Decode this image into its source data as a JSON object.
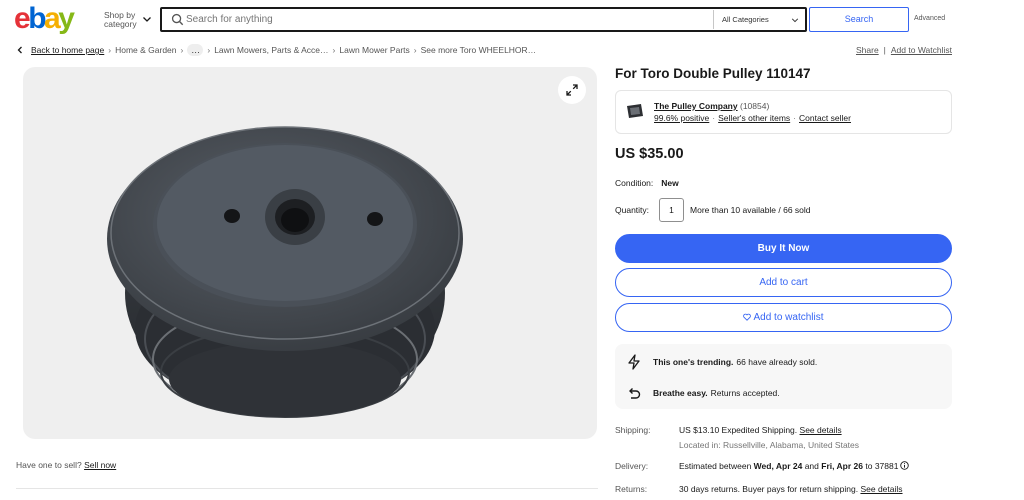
{
  "header": {
    "logo": {
      "e": "e",
      "b": "b",
      "a": "a",
      "y": "y"
    },
    "shop_by_category": "Shop by category",
    "search_placeholder": "Search for anything",
    "category_select": "All Categories",
    "search_button": "Search",
    "advanced": "Advanced"
  },
  "breadcrumb": {
    "back": "Back to home page",
    "items": [
      "Home & Garden",
      "…",
      "Lawn Mowers, Parts & Acce…",
      "Lawn Mower Parts",
      "See more Toro WHEELHOR…"
    ],
    "share": "Share",
    "watchlist": "Add to Watchlist"
  },
  "sell": {
    "prompt": "Have one to sell?",
    "link": "Sell now"
  },
  "product": {
    "title": "For Toro Double Pulley 110147",
    "price": "US $35.00",
    "condition_label": "Condition:",
    "condition_value": "New",
    "quantity_label": "Quantity:",
    "quantity_value": "1",
    "availability": "More than 10 available / 66 sold"
  },
  "seller": {
    "name": "The Pulley Company",
    "feedback": "(10854)",
    "positive": "99.6% positive",
    "other_items": "Seller's other items",
    "contact": "Contact seller"
  },
  "actions": {
    "buy": "Buy It Now",
    "cart": "Add to cart",
    "watch": "Add to watchlist"
  },
  "highlights": {
    "trending_bold": "This one's trending.",
    "trending_text": "66 have already sold.",
    "returns_bold": "Breathe easy.",
    "returns_text": "Returns accepted."
  },
  "details": {
    "shipping_label": "Shipping:",
    "shipping_value": "US $13.10 Expedited Shipping.",
    "shipping_link": "See details",
    "location": "Located in: Russellville, Alabama, United States",
    "delivery_label": "Delivery:",
    "delivery_prefix": "Estimated between",
    "delivery_start": "Wed, Apr 24",
    "delivery_and": "and",
    "delivery_end": "Fri, Apr 26",
    "delivery_to": "to 37881",
    "returns_label": "Returns:",
    "returns_value": "30 days returns. Buyer pays for return shipping.",
    "returns_link": "See details"
  },
  "colors": {
    "accent": "#3665f3",
    "logo_red": "#e53238",
    "logo_blue": "#0064d2",
    "logo_yellow": "#f5af02",
    "logo_green": "#86b817"
  },
  "icons": [
    "search-icon",
    "chevron-down-icon",
    "chevron-left-icon",
    "expand-icon",
    "heart-icon",
    "lightning-icon",
    "return-arrow-icon",
    "info-icon",
    "seller-logo-icon"
  ]
}
